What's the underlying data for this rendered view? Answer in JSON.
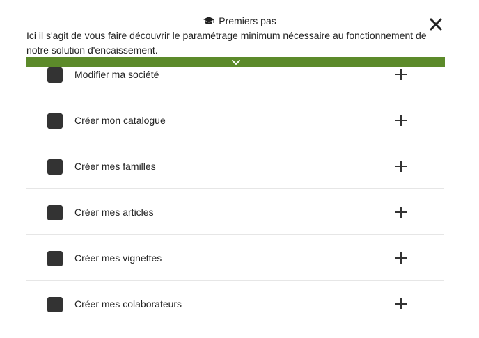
{
  "dialog": {
    "title": "Premiers pas",
    "title_icon": "graduation-cap-icon",
    "close_icon": "close-icon",
    "intro": "Ici il s'agit de vous faire découvrir le paramétrage minimum nécessaire au fonctionnement de notre solution d'encaissement.",
    "collapse_icon": "chevron-down-icon",
    "accent_color": "#5c8a2a"
  },
  "steps": [
    {
      "label": "Modifier ma société",
      "expand_icon": "plus-icon"
    },
    {
      "label": "Créer mon catalogue",
      "expand_icon": "plus-icon"
    },
    {
      "label": "Créer mes familles",
      "expand_icon": "plus-icon"
    },
    {
      "label": "Créer mes articles",
      "expand_icon": "plus-icon"
    },
    {
      "label": "Créer mes vignettes",
      "expand_icon": "plus-icon"
    },
    {
      "label": "Créer mes colaborateurs",
      "expand_icon": "plus-icon"
    }
  ]
}
